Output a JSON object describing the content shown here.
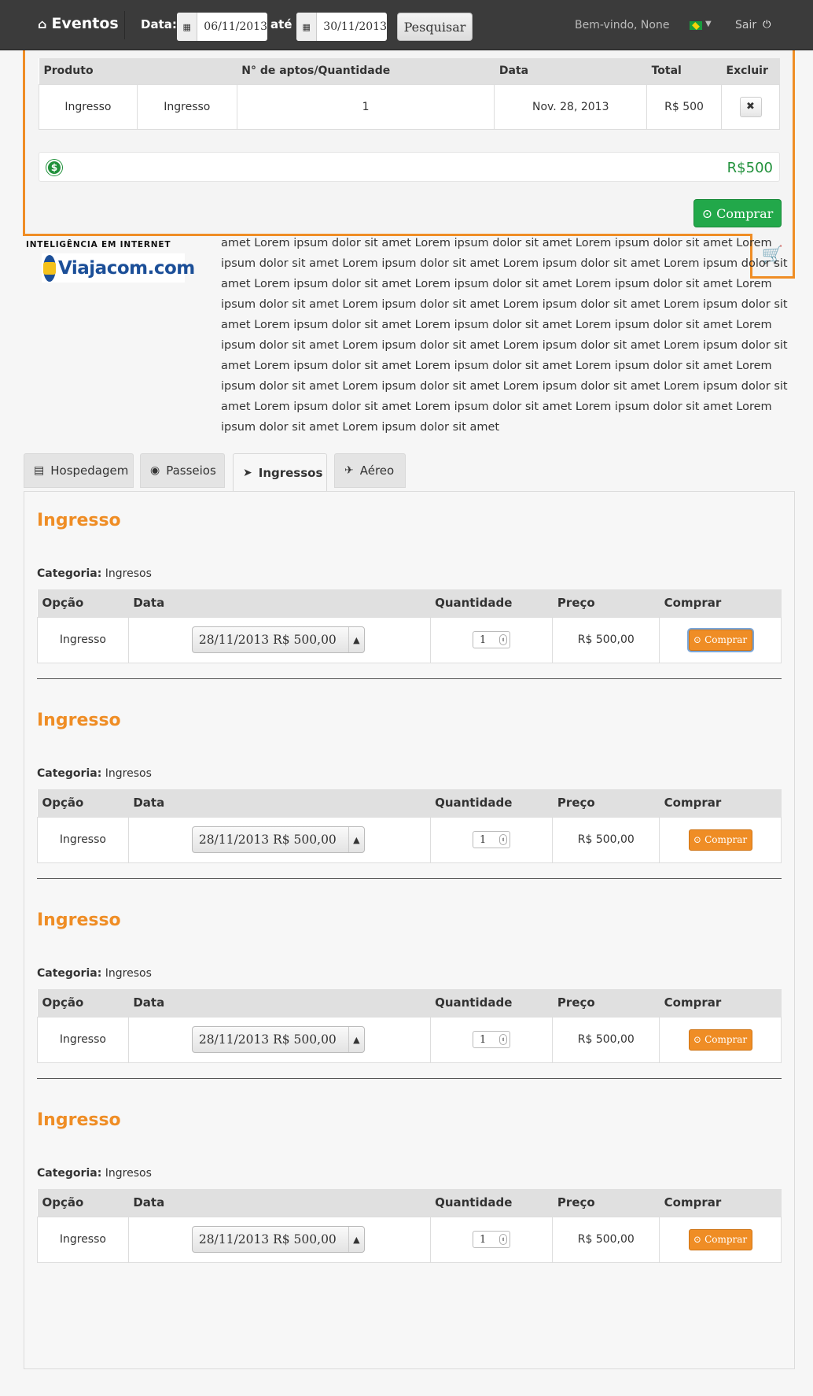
{
  "navbar": {
    "brand": "Eventos",
    "date_label": "Data:",
    "date_from": "06/11/2013",
    "until_label": "até",
    "date_to": "30/11/2013",
    "search_label": "Pesquisar",
    "welcome": "Bem-vindo, None",
    "logout": "Sair"
  },
  "cart": {
    "headers": [
      "Produto",
      "N° de aptos/Quantidade",
      "Data",
      "Total",
      "Excluir"
    ],
    "row": {
      "produto": "Ingresso",
      "tipo": "Ingresso",
      "quantidade": "1",
      "data": "Nov. 28, 2013",
      "total": "R$ 500"
    },
    "total": "R$500",
    "buy_label": "Comprar"
  },
  "logo": {
    "tagline": "INTELIGÊNCIA EM INTERNET",
    "name": "Viajacom.com"
  },
  "description": "amet Lorem ipsum dolor sit amet Lorem ipsum dolor sit amet Lorem ipsum dolor sit amet Lorem ipsum dolor sit amet Lorem ipsum dolor sit amet Lorem ipsum dolor sit amet Lorem ipsum dolor sit amet Lorem ipsum dolor sit amet Lorem ipsum dolor sit amet Lorem ipsum dolor sit amet Lorem ipsum dolor sit amet Lorem ipsum dolor sit amet Lorem ipsum dolor sit amet Lorem ipsum dolor sit amet Lorem ipsum dolor sit amet Lorem ipsum dolor sit amet Lorem ipsum dolor sit amet Lorem ipsum dolor sit amet Lorem ipsum dolor sit amet Lorem ipsum dolor sit amet Lorem ipsum dolor sit amet Lorem ipsum dolor sit amet Lorem ipsum dolor sit amet Lorem ipsum dolor sit amet Lorem ipsum dolor sit amet Lorem ipsum dolor sit amet Lorem ipsum dolor sit amet Lorem ipsum dolor sit amet Lorem ipsum dolor sit amet Lorem ipsum dolor sit amet Lorem ipsum dolor sit amet Lorem ipsum dolor sit amet Lorem ipsum dolor sit amet",
  "tabs": [
    {
      "label": "Hospedagem",
      "icon": "bed-icon"
    },
    {
      "label": "Passeios",
      "icon": "camera-icon"
    },
    {
      "label": "Ingressos",
      "icon": "ticket-icon"
    },
    {
      "label": "Aéreo",
      "icon": "plane-icon"
    }
  ],
  "products": {
    "headers": [
      "Opção",
      "Data",
      "Quantidade",
      "Preço",
      "Comprar"
    ],
    "category_label": "Categoria:",
    "items": [
      {
        "title": "Ingresso",
        "category": "Ingresos",
        "option": "Ingresso",
        "date_select": "28/11/2013 R$ 500,00",
        "quantity": "1",
        "price": "R$ 500,00",
        "buy_label": "Comprar"
      },
      {
        "title": "Ingresso",
        "category": "Ingresos",
        "option": "Ingresso",
        "date_select": "28/11/2013 R$ 500,00",
        "quantity": "1",
        "price": "R$ 500,00",
        "buy_label": "Comprar"
      },
      {
        "title": "Ingresso",
        "category": "Ingresos",
        "option": "Ingresso",
        "date_select": "28/11/2013 R$ 500,00",
        "quantity": "1",
        "price": "R$ 500,00",
        "buy_label": "Comprar"
      },
      {
        "title": "Ingresso",
        "category": "Ingresos",
        "option": "Ingresso",
        "date_select": "28/11/2013 R$ 500,00",
        "quantity": "1",
        "price": "R$ 500,00",
        "buy_label": "Comprar"
      }
    ]
  },
  "colors": {
    "accent": "#ef8d25",
    "success": "#22a84a",
    "navbar": "#3b3b3b"
  }
}
